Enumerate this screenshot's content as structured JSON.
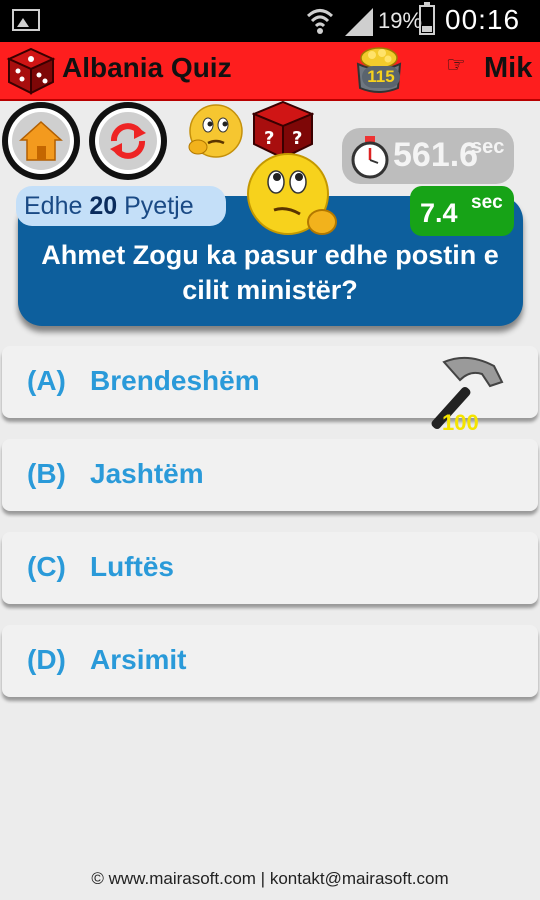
{
  "status_bar": {
    "battery_percent": "19%",
    "time": "00:16",
    "icons": [
      "image-icon",
      "wifi-icon",
      "signal-icon",
      "battery-icon"
    ]
  },
  "app_bar": {
    "title": "Albania Quiz",
    "coins": "115",
    "user_icon": "☞",
    "user": "Mik",
    "color": "#fe1e1e"
  },
  "controls": {
    "home_icon": "home-icon",
    "reload_icon": "reload-icon"
  },
  "timer": {
    "value": "561.6",
    "unit": "sec"
  },
  "question_panel": {
    "remaining_prefix": "Edhe",
    "remaining_count": "20",
    "remaining_suffix": "Pyetje",
    "time_value": "7.4",
    "time_unit": "sec",
    "question": "Ahmet Zogu ka pasur edhe postin e cilit ministër?",
    "color": "#0d5f9d"
  },
  "answers": [
    {
      "letter": "(A)",
      "text": "Brendeshëm"
    },
    {
      "letter": "(B)",
      "text": "Jashtëm"
    },
    {
      "letter": "(C)",
      "text": "Luftës"
    },
    {
      "letter": "(D)",
      "text": "Arsimit"
    }
  ],
  "hammer": {
    "count": "100"
  },
  "footer": {
    "text": "© www.mairasoft.com | kontakt@mairasoft.com"
  }
}
